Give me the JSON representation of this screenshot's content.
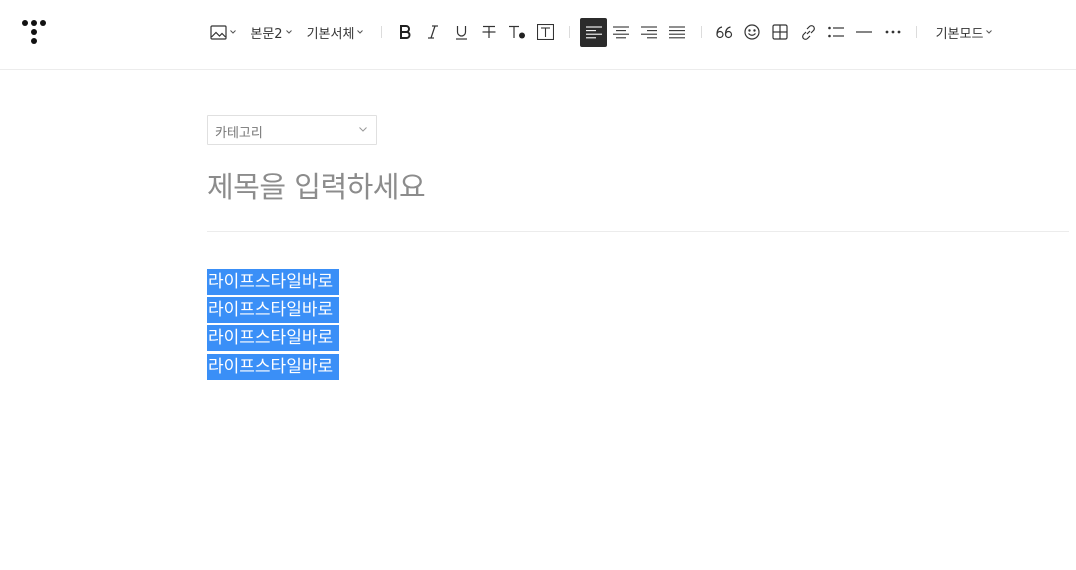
{
  "toolbar": {
    "paragraph_style": "본문2",
    "font_family": "기본서체",
    "mode": "기본모드"
  },
  "editor": {
    "category_placeholder": "카테고리",
    "title_placeholder": "제목을 입력하세요",
    "lines": [
      "라이프스타일바로",
      "라이프스타일바로",
      "라이프스타일바로",
      "라이프스타일바로"
    ]
  }
}
